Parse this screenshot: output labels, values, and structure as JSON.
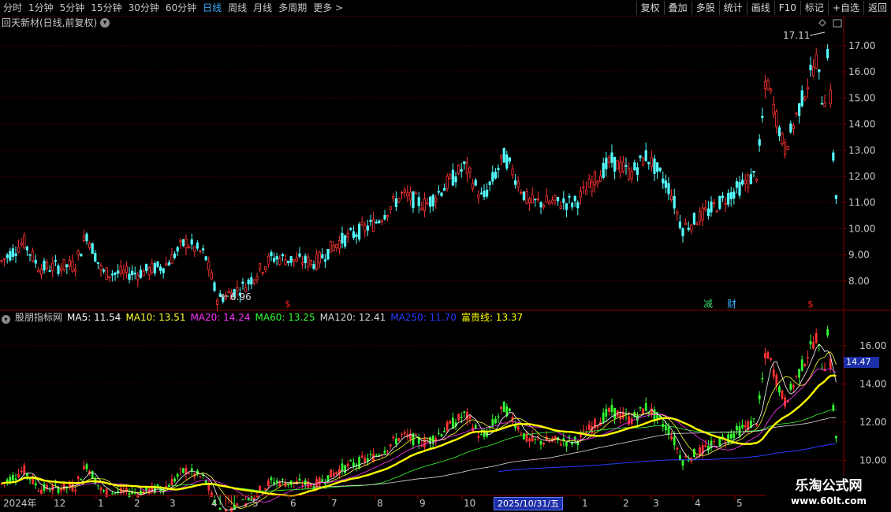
{
  "toolbar": {
    "periods": [
      "分时",
      "1分钟",
      "5分钟",
      "15分钟",
      "30分钟",
      "60分钟",
      "日线",
      "周线",
      "月线",
      "多周期",
      "更多 >"
    ],
    "active_index": 6,
    "right_buttons": [
      "复权",
      "叠加",
      "多股",
      "统计",
      "画线",
      "F10",
      "标记",
      "+自选",
      "返回"
    ]
  },
  "main_chart": {
    "title": "回天新材(日线,前复权)",
    "y_ticks": [
      "17.00",
      "16.00",
      "15.00",
      "14.00",
      "13.00",
      "12.00",
      "11.00",
      "10.00",
      "9.00",
      "8.00"
    ],
    "y_tick_values": [
      17,
      16,
      15,
      14,
      13,
      12,
      11,
      10,
      9,
      8
    ],
    "ylim": [
      7.0,
      17.6
    ],
    "high_label": "17.11",
    "low_label": "6.96",
    "markers": [
      "$",
      "减",
      "财",
      "$"
    ],
    "marker_colors": [
      "#e02020",
      "#39d36b",
      "#39b0ff",
      "#e02020"
    ]
  },
  "indicator": {
    "name": "股朋指标网",
    "lines": [
      {
        "label": "MA5: 11.54",
        "color": "#ffffff"
      },
      {
        "label": "MA10: 13.51",
        "color": "#ffff33"
      },
      {
        "label": "MA20: 14.24",
        "color": "#ff33ff"
      },
      {
        "label": "MA60: 13.25",
        "color": "#33ff33"
      },
      {
        "label": "MA120: 12.41",
        "color": "#d8d8d8"
      },
      {
        "label": "MA250: 11.70",
        "color": "#2b3bff"
      },
      {
        "label": "富贵线: 13.37",
        "color": "#ffff00"
      }
    ],
    "y_ticks": [
      "16.00",
      "14.00",
      "12.00",
      "10.00"
    ],
    "y_tick_values": [
      16,
      14,
      12,
      10
    ],
    "ylim": [
      8.2,
      17.4
    ],
    "current_price": "14.47"
  },
  "x_axis": {
    "labels": [
      "2024年",
      "12",
      "1",
      "2",
      "3",
      "4",
      "5",
      "6",
      "7",
      "8",
      "9",
      "10",
      "1",
      "2",
      "3",
      "4",
      "5"
    ],
    "cursor_date": "2025/10/31/五"
  },
  "chart_data": {
    "type": "candlestick",
    "title": "回天新材(日线,前复权)",
    "anchors": [
      [
        0,
        8.7
      ],
      [
        30,
        9.5
      ],
      [
        50,
        8.5
      ],
      [
        95,
        8.6
      ],
      [
        110,
        9.8
      ],
      [
        130,
        8.3
      ],
      [
        175,
        8.3
      ],
      [
        210,
        8.6
      ],
      [
        235,
        9.5
      ],
      [
        260,
        9.0
      ],
      [
        276,
        7.3
      ],
      [
        310,
        7.8
      ],
      [
        345,
        8.9
      ],
      [
        400,
        8.7
      ],
      [
        430,
        9.5
      ],
      [
        475,
        10.2
      ],
      [
        510,
        11.3
      ],
      [
        540,
        10.9
      ],
      [
        590,
        12.4
      ],
      [
        612,
        11.1
      ],
      [
        640,
        12.8
      ],
      [
        670,
        11.0
      ],
      [
        730,
        11.0
      ],
      [
        775,
        12.6
      ],
      [
        800,
        12.1
      ],
      [
        820,
        12.8
      ],
      [
        850,
        11.5
      ],
      [
        865,
        10.0
      ],
      [
        900,
        10.7
      ],
      [
        960,
        12.1
      ],
      [
        972,
        15.8
      ],
      [
        995,
        13.0
      ],
      [
        1035,
        16.5
      ],
      [
        1045,
        14.5
      ],
      [
        1050,
        17.0
      ],
      [
        1058,
        12.0
      ],
      [
        1063,
        10.5
      ]
    ],
    "ylim": [
      7.0,
      17.6
    ]
  },
  "watermark": {
    "title": "乐淘公式网",
    "url": "www.60lt.com"
  }
}
